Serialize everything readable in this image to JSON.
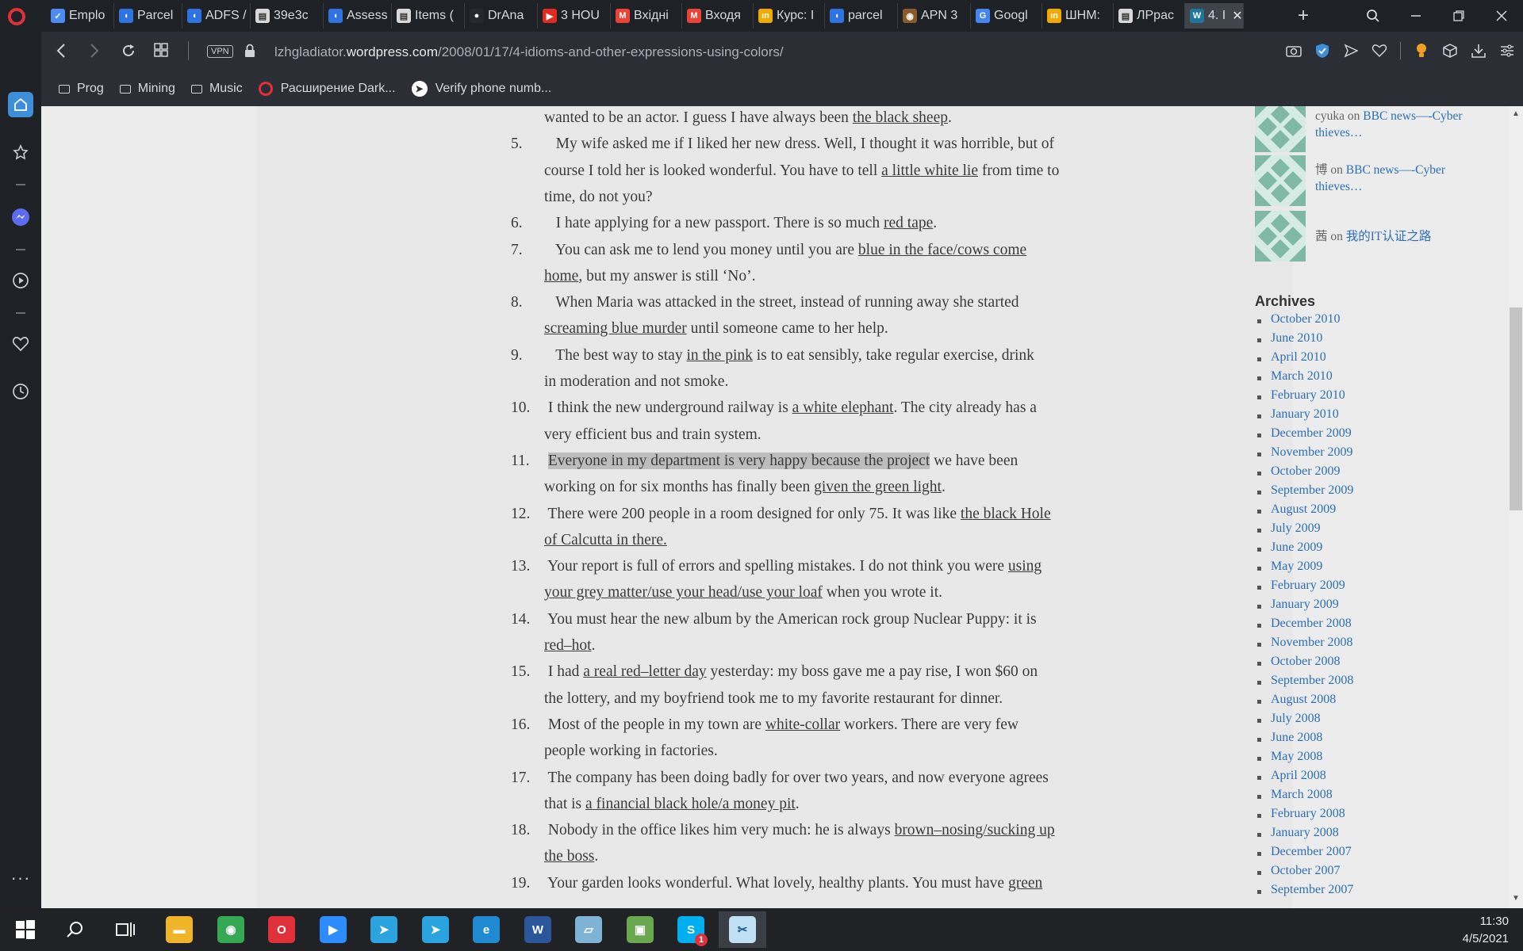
{
  "browser": {
    "tabs": [
      {
        "label": "Emplo",
        "color": "#4c8bf5",
        "glyph": "✓"
      },
      {
        "label": "Parcel",
        "color": "#2f73e0",
        "glyph": "◖"
      },
      {
        "label": "ADFS /",
        "color": "#2f73e0",
        "glyph": "◖"
      },
      {
        "label": "39e3c",
        "color": "#d9d9d9",
        "glyph": "▤"
      },
      {
        "label": "Assess",
        "color": "#2f73e0",
        "glyph": "◖"
      },
      {
        "label": "Items (",
        "color": "#d9d9d9",
        "glyph": "▤"
      },
      {
        "label": "DrAna",
        "color": "#24292e",
        "glyph": "●"
      },
      {
        "label": "3 HOU",
        "color": "#e02b20",
        "glyph": "▶"
      },
      {
        "label": "Вхідні",
        "color": "#ea4335",
        "glyph": "M"
      },
      {
        "label": "Входя",
        "color": "#ea4335",
        "glyph": "M"
      },
      {
        "label": "Курс: I",
        "color": "#f2a900",
        "glyph": "ın"
      },
      {
        "label": "parcel",
        "color": "#2f73e0",
        "glyph": "◖"
      },
      {
        "label": "APN 3",
        "color": "#8a5a2b",
        "glyph": "◉"
      },
      {
        "label": "Googl",
        "color": "#4285f4",
        "glyph": "G"
      },
      {
        "label": "ШНМ:",
        "color": "#f2a900",
        "glyph": "ın"
      },
      {
        "label": "ЛРрас",
        "color": "#d9d9d9",
        "glyph": "▤"
      },
      {
        "label": "4. I",
        "color": "#21759b",
        "glyph": "W",
        "active": true
      }
    ],
    "address": {
      "vpn": "VPN",
      "url_prefix": "lzhgladiator.",
      "url_domain": "wordpress.com",
      "url_path": "/2008/01/17/4-idioms-and-other-expressions-using-colors/"
    },
    "bookmarks": [
      {
        "label": "Prog",
        "type": "folder"
      },
      {
        "label": "Mining",
        "type": "folder"
      },
      {
        "label": "Music",
        "type": "folder"
      },
      {
        "label": "Расширение Dark...",
        "type": "opera",
        "color": "#e0303a"
      },
      {
        "label": "Verify phone numb...",
        "type": "site",
        "color": "#ffffff"
      }
    ]
  },
  "article": {
    "lines": [
      {
        "num": "",
        "parts": [
          {
            "t": "wanted to be an actor. I guess I have always been "
          },
          {
            "t": "the black sheep",
            "u": true
          },
          {
            "t": "."
          }
        ]
      },
      {
        "num": "5.",
        "parts": [
          {
            "t": "   My wife asked me if I liked her new dress. Well, I thought it was horrible, but of"
          }
        ]
      },
      {
        "num": "",
        "parts": [
          {
            "t": "course I told her is looked wonderful. You have to tell "
          },
          {
            "t": "a little white lie",
            "u": true
          },
          {
            "t": " from time to"
          }
        ]
      },
      {
        "num": "",
        "parts": [
          {
            "t": "time, do not you?"
          }
        ]
      },
      {
        "num": "6.",
        "parts": [
          {
            "t": "   I hate applying for a new passport. There is so much "
          },
          {
            "t": "red tape",
            "u": true
          },
          {
            "t": "."
          }
        ]
      },
      {
        "num": "7.",
        "parts": [
          {
            "t": "   You can ask me to lend you money until you are "
          },
          {
            "t": "blue in the face/cows come",
            "u": true
          }
        ]
      },
      {
        "num": "",
        "parts": [
          {
            "t": "home",
            "u": true
          },
          {
            "t": ", but my answer is still ‘No’."
          }
        ]
      },
      {
        "num": "8.",
        "parts": [
          {
            "t": "   When Maria was attacked in the street, instead of running away she started"
          }
        ]
      },
      {
        "num": "",
        "parts": [
          {
            "t": "screaming blue murder",
            "u": true
          },
          {
            "t": " until someone came to her help."
          }
        ]
      },
      {
        "num": "9.",
        "parts": [
          {
            "t": "   The best way to stay "
          },
          {
            "t": "in the pink",
            "u": true
          },
          {
            "t": " is to eat sensibly, take regular exercise, drink"
          }
        ]
      },
      {
        "num": "",
        "parts": [
          {
            "t": "in moderation and not smoke."
          }
        ]
      },
      {
        "num": "10.",
        "parts": [
          {
            "t": " I think the new underground railway is "
          },
          {
            "t": "a white elephant",
            "u": true
          },
          {
            "t": ". The city already has a"
          }
        ]
      },
      {
        "num": "",
        "parts": [
          {
            "t": "very efficient bus and train system."
          }
        ]
      },
      {
        "num": "11.",
        "parts": [
          {
            "t": " "
          },
          {
            "t": "Everyone in my department is very happy because the project",
            "hl": true
          },
          {
            "t": " we have been"
          }
        ]
      },
      {
        "num": "",
        "parts": [
          {
            "t": "working on for six months has finally been "
          },
          {
            "t": "given the green light",
            "u": true
          },
          {
            "t": "."
          }
        ]
      },
      {
        "num": "12.",
        "parts": [
          {
            "t": " There were 200 people in a room designed for only 75. It was like "
          },
          {
            "t": "the black Hole",
            "u": true
          }
        ]
      },
      {
        "num": "",
        "parts": [
          {
            "t": "of Calcutta in there.",
            "u": true
          }
        ]
      },
      {
        "num": "13.",
        "parts": [
          {
            "t": " Your report is full of errors and spelling mistakes. I do not think you were "
          },
          {
            "t": "using",
            "u": true
          }
        ]
      },
      {
        "num": "",
        "parts": [
          {
            "t": "your grey matter/use your head/use your loaf",
            "u": true
          },
          {
            "t": " when you wrote it."
          }
        ]
      },
      {
        "num": "14.",
        "parts": [
          {
            "t": " You must hear the new album by the American rock group Nuclear Puppy: it is"
          }
        ]
      },
      {
        "num": "",
        "parts": [
          {
            "t": "red–hot",
            "u": true
          },
          {
            "t": "."
          }
        ]
      },
      {
        "num": "15.",
        "parts": [
          {
            "t": " I had "
          },
          {
            "t": "a real red–letter day",
            "u": true
          },
          {
            "t": " yesterday: my boss gave me a pay rise, I won $60 on"
          }
        ]
      },
      {
        "num": "",
        "parts": [
          {
            "t": "the lottery, and my boyfriend took me to my favorite restaurant for dinner."
          }
        ]
      },
      {
        "num": "16.",
        "parts": [
          {
            "t": " Most of the people in my town are "
          },
          {
            "t": "white-collar",
            "u": true
          },
          {
            "t": " workers. There are very few"
          }
        ]
      },
      {
        "num": "",
        "parts": [
          {
            "t": "people working in factories."
          }
        ]
      },
      {
        "num": "17.",
        "parts": [
          {
            "t": " The company has been doing badly for over two years, and now everyone agrees"
          }
        ]
      },
      {
        "num": "",
        "parts": [
          {
            "t": "that is "
          },
          {
            "t": "a financial black hole/a money pit",
            "u": true
          },
          {
            "t": "."
          }
        ]
      },
      {
        "num": "18.",
        "parts": [
          {
            "t": " Nobody in the office likes him very much: he is always "
          },
          {
            "t": "brown–nosing/sucking up",
            "u": true
          }
        ]
      },
      {
        "num": "",
        "parts": [
          {
            "t": "the boss",
            "u": true
          },
          {
            "t": "."
          }
        ]
      },
      {
        "num": "19.",
        "parts": [
          {
            "t": " Your garden looks wonderful. What lovely, healthy plants. You must have "
          },
          {
            "t": "green",
            "u": true
          }
        ]
      }
    ]
  },
  "sidebar_widget": {
    "comments": [
      {
        "author": "cyuka",
        "on": "on",
        "link": "BBC news—-Cyber thieves…"
      },
      {
        "author": "博",
        "on": "on",
        "link": "BBC news—-Cyber thieves…"
      },
      {
        "author": "茜",
        "on": "on",
        "link": "我的IT认证之路"
      }
    ],
    "archives_title": "Archives",
    "archives": [
      "October 2010",
      "June 2010",
      "April 2010",
      "March 2010",
      "February 2010",
      "January 2010",
      "December 2009",
      "November 2009",
      "October 2009",
      "September 2009",
      "August 2009",
      "July 2009",
      "June 2009",
      "May 2009",
      "February 2009",
      "January 2009",
      "December 2008",
      "November 2008",
      "October 2008",
      "September 2008",
      "August 2008",
      "July 2008",
      "June 2008",
      "May 2008",
      "April 2008",
      "March 2008",
      "February 2008",
      "January 2008",
      "December 2007",
      "October 2007",
      "September 2007"
    ]
  },
  "taskbar": {
    "apps": [
      {
        "name": "file-explorer",
        "color": "#f0b429",
        "glyph": "▬"
      },
      {
        "name": "chrome",
        "color": "#34a853",
        "glyph": "◉"
      },
      {
        "name": "opera",
        "color": "#e0303a",
        "glyph": "O"
      },
      {
        "name": "zoom",
        "color": "#2d8cff",
        "glyph": "▶"
      },
      {
        "name": "telegram",
        "color": "#2aa3df",
        "glyph": "➤"
      },
      {
        "name": "telegram-2",
        "color": "#2aa3df",
        "glyph": "➤"
      },
      {
        "name": "edge",
        "color": "#1f8ad2",
        "glyph": "e"
      },
      {
        "name": "word",
        "color": "#2b579a",
        "glyph": "W"
      },
      {
        "name": "notes",
        "color": "#7fb3d5",
        "glyph": "▱"
      },
      {
        "name": "image-editor",
        "color": "#6aa84f",
        "glyph": "▣"
      },
      {
        "name": "skype",
        "color": "#00aff0",
        "glyph": "S",
        "badge": "1"
      },
      {
        "name": "snipping-tool",
        "color": "#bfe0f5",
        "glyph": "✂",
        "active": true
      }
    ],
    "time": "11:30",
    "date": "4/5/2021"
  }
}
